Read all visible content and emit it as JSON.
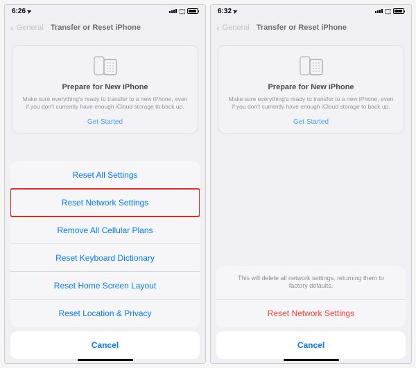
{
  "left": {
    "status": {
      "time": "6:26",
      "location_glyph": "➤"
    },
    "nav": {
      "back": "General",
      "title": "Transfer or Reset iPhone"
    },
    "card": {
      "title": "Prepare for New iPhone",
      "desc": "Make sure everything's ready to transfer to a new iPhone, even if you don't currently have enough iCloud storage to back up.",
      "link": "Get Started"
    },
    "sheet": {
      "items": [
        "Reset All Settings",
        "Reset Network Settings",
        "Remove All Cellular Plans",
        "Reset Keyboard Dictionary",
        "Reset Home Screen Layout",
        "Reset Location & Privacy"
      ],
      "highlighted_index": 1,
      "cancel": "Cancel"
    }
  },
  "right": {
    "status": {
      "time": "6:32",
      "location_glyph": "➤"
    },
    "nav": {
      "back": "General",
      "title": "Transfer or Reset iPhone"
    },
    "card": {
      "title": "Prepare for New iPhone",
      "desc": "Make sure everything's ready to transfer to a new iPhone, even if you don't currently have enough iCloud storage to back up.",
      "link": "Get Started"
    },
    "confirm": {
      "message": "This will delete all network settings, returning them to factory defaults.",
      "action": "Reset Network Settings",
      "cancel": "Cancel"
    }
  },
  "colors": {
    "accent": "#007aff",
    "destructive": "#ff3b30",
    "highlight": "#e8291f"
  }
}
